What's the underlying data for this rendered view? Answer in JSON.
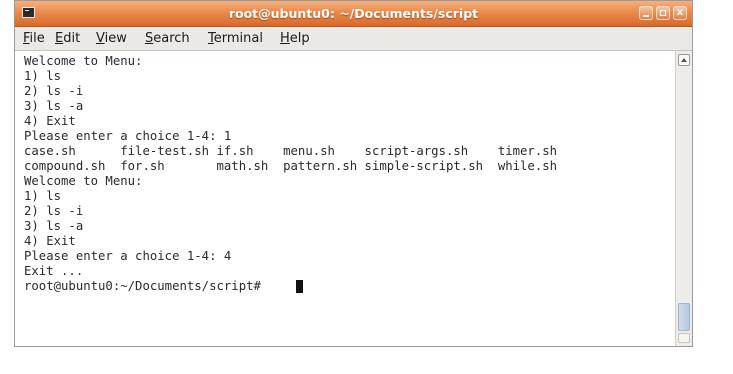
{
  "window": {
    "title": "root@ubuntu0: ~/Documents/script",
    "controls": {
      "minimize": "",
      "maximize": "",
      "close": "x"
    }
  },
  "menu": {
    "items": [
      "File",
      "Edit",
      "View",
      "Search",
      "Terminal",
      "Help"
    ]
  },
  "terminal": {
    "lines": [
      "Welcome to Menu:",
      "1) ls",
      "2) ls -i",
      "3) ls -a",
      "4) Exit",
      "Please enter a choice 1-4: 1",
      "case.sh      file-test.sh if.sh    menu.sh    script-args.sh    timer.sh",
      "compound.sh  for.sh       math.sh  pattern.sh simple-script.sh  while.sh",
      "Welcome to Menu:",
      "1) ls",
      "2) ls -i",
      "3) ls -a",
      "4) Exit",
      "Please enter a choice 1-4: 4",
      "Exit ...",
      "root@ubuntu0:~/Documents/script# "
    ]
  },
  "colors": {
    "titlebar": "#e07a3a",
    "terminal_background": "#ffffff",
    "terminal_text": "#2b2b2b"
  }
}
